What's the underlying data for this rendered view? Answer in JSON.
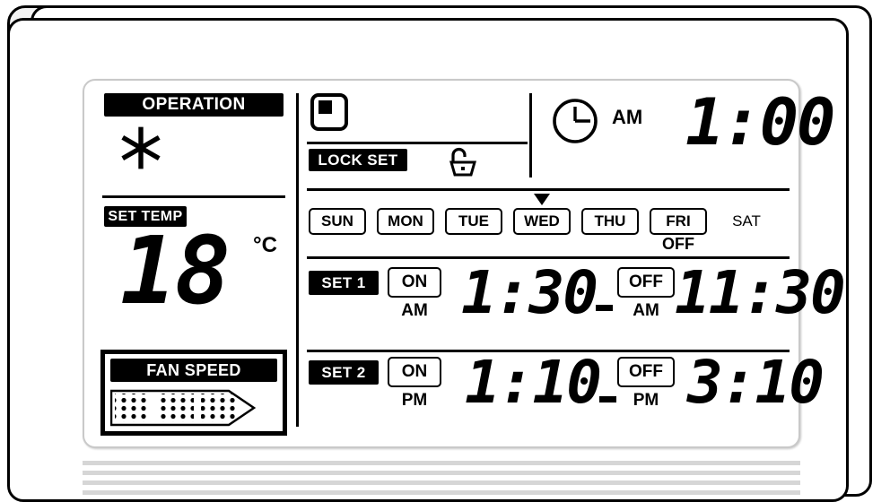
{
  "device": {
    "name": "air-conditioner-remote-lcd"
  },
  "lcd": {
    "left": {
      "operation_label": "OPERATION",
      "operation_mode_icon": "snowflake-cool-icon",
      "set_temp_label": "SET TEMP",
      "set_temp_value": "18",
      "set_temp_unit": "°C",
      "fan_speed_label": "FAN SPEED",
      "fan_speed_icon": "dot-matrix-arrow-icon"
    },
    "top": {
      "mode_square_icon": "rounded-square-indicator-icon",
      "lock_set_label": "LOCK SET",
      "padlock_icon": "open-padlock-icon",
      "clock_icon": "analog-clock-icon",
      "clock_ampm": "AM",
      "clock_time": "1:00"
    },
    "days": {
      "items": [
        {
          "label": "SUN",
          "boxed": true,
          "marker": false,
          "sub": ""
        },
        {
          "label": "MON",
          "boxed": true,
          "marker": false,
          "sub": ""
        },
        {
          "label": "TUE",
          "boxed": true,
          "marker": false,
          "sub": ""
        },
        {
          "label": "WED",
          "boxed": true,
          "marker": true,
          "sub": ""
        },
        {
          "label": "THU",
          "boxed": true,
          "marker": false,
          "sub": ""
        },
        {
          "label": "FRI",
          "boxed": true,
          "marker": false,
          "sub": "OFF"
        },
        {
          "label": "SAT",
          "boxed": false,
          "marker": false,
          "sub": ""
        }
      ],
      "selected_day": "WED",
      "off_day": "FRI",
      "off_label": "OFF"
    },
    "timers": [
      {
        "tag": "SET 1",
        "on_label": "ON",
        "on_ampm": "AM",
        "on_time": "1:30",
        "separator": "-",
        "off_label": "OFF",
        "off_ampm": "AM",
        "off_time": "11:30"
      },
      {
        "tag": "SET 2",
        "on_label": "ON",
        "on_ampm": "PM",
        "on_time": "1:10",
        "separator": "-",
        "off_label": "OFF",
        "off_ampm": "PM",
        "off_time": "3:10"
      }
    ]
  },
  "colors": {
    "lcd_background": "#ffffff",
    "lcd_ink": "#000000",
    "bezel": "#f3f3f3",
    "grille": "#d6d6d6"
  }
}
